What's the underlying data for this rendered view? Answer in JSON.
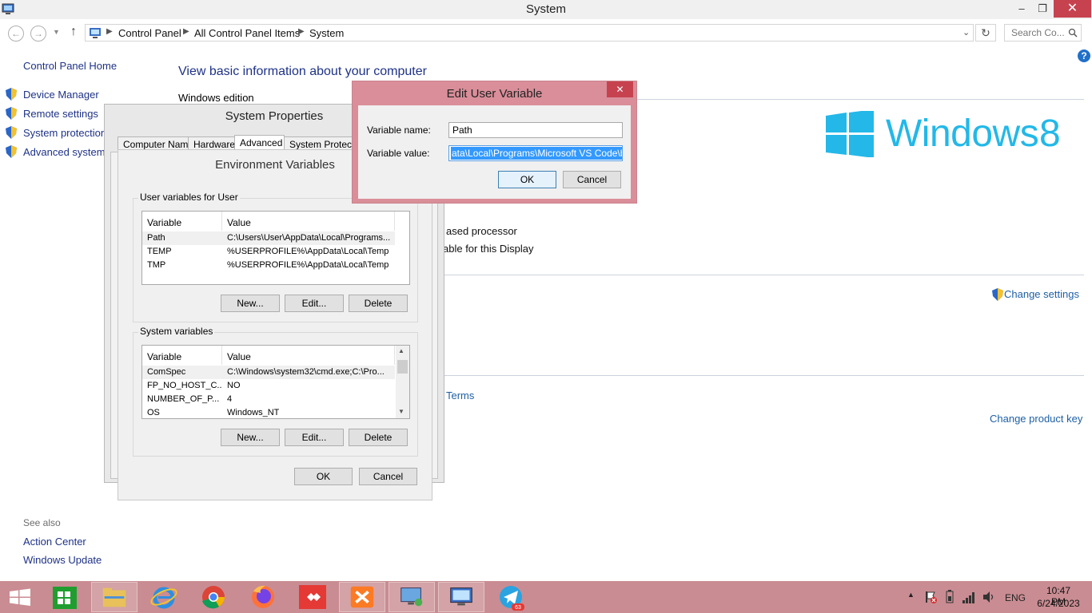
{
  "window": {
    "title": "System"
  },
  "address": {
    "crumbs": [
      "Control Panel",
      "All Control Panel Items",
      "System"
    ],
    "search_placeholder": "Search Co..."
  },
  "left_pane": {
    "home": "Control Panel Home",
    "links": [
      "Device Manager",
      "Remote settings",
      "System protection",
      "Advanced system s"
    ],
    "see_also_title": "See also",
    "see_also": [
      "Action Center",
      "Windows Update"
    ]
  },
  "main": {
    "title": "View basic information about your computer",
    "windows_edition": "Windows edition",
    "processor_fragment": "ased processor",
    "display_fragment": "able for this Display",
    "change_settings": "Change settings",
    "terms_fragment": "Terms",
    "change_product_key": "Change product key",
    "logo_text": "Windows",
    "logo_version": "8"
  },
  "system_properties": {
    "title": "System Properties",
    "tabs": [
      "Computer Name",
      "Hardware",
      "Advanced",
      "System Protection"
    ],
    "active_tab": "Advanced"
  },
  "env_vars": {
    "title": "Environment Variables",
    "user_group": "User variables for User",
    "system_group": "System variables",
    "col_variable": "Variable",
    "col_value": "Value",
    "user_vars": [
      {
        "name": "Path",
        "value": "C:\\Users\\User\\AppData\\Local\\Programs..."
      },
      {
        "name": "TEMP",
        "value": "%USERPROFILE%\\AppData\\Local\\Temp"
      },
      {
        "name": "TMP",
        "value": "%USERPROFILE%\\AppData\\Local\\Temp"
      }
    ],
    "system_vars": [
      {
        "name": "ComSpec",
        "value": "C:\\Windows\\system32\\cmd.exe;C:\\Pro..."
      },
      {
        "name": "FP_NO_HOST_C...",
        "value": "NO"
      },
      {
        "name": "NUMBER_OF_P...",
        "value": "4"
      },
      {
        "name": "OS",
        "value": "Windows_NT"
      }
    ],
    "new_label": "New...",
    "edit_label": "Edit...",
    "delete_label": "Delete",
    "ok_label": "OK",
    "cancel_label": "Cancel"
  },
  "edit_user_variable": {
    "title": "Edit User Variable",
    "name_label": "Variable name:",
    "name_value": "Path",
    "value_label": "Variable value:",
    "value_value": "ata\\Local\\Programs\\Microsoft VS Code\\bin;",
    "ok_label": "OK",
    "cancel_label": "Cancel"
  },
  "taskbar": {
    "apps": [
      "start",
      "store",
      "file-explorer",
      "internet-explorer",
      "chrome",
      "firefox",
      "anydesk",
      "xampp",
      "control-panel-network",
      "system",
      "telegram"
    ],
    "telegram_badge": "63",
    "language": "ENG",
    "time": "10:47 PM",
    "date": "6/24/2023"
  },
  "colors": {
    "accent_link": "#1e3287",
    "win8_logo": "#23b8e8",
    "taskbar": "#c98c92",
    "close_button": "#c7424f"
  }
}
